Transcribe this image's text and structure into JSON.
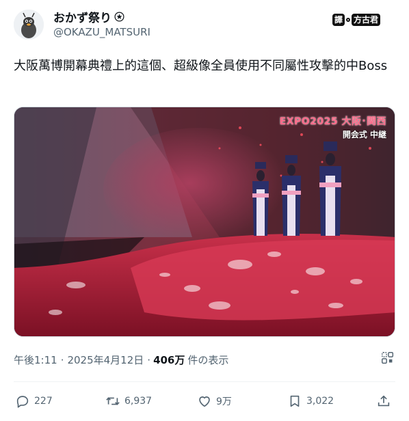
{
  "author": {
    "display_name": "おかず祭り",
    "handle": "@OKAZU_MATSURI",
    "avatar_icon": "cartoon-avatar",
    "badge_icon": "circled-star-badge"
  },
  "watermark": {
    "left": "譯",
    "right": "方古君"
  },
  "tweet": {
    "text": "大阪萬博開幕典禮上的這個、超級像全員使用不同屬性攻擊的中Boss"
  },
  "media": {
    "overlay_line1": "EXPO2025 大阪･関西",
    "overlay_line2": "開会式 中継"
  },
  "meta": {
    "time": "午後1:11",
    "sep1": "·",
    "date": "2025年4月12日",
    "sep2": "·",
    "views_count": "406万",
    "views_label": "件の表示"
  },
  "actions": {
    "replies": "227",
    "retweets": "6,937",
    "likes": "9万",
    "bookmarks": "3,022"
  },
  "colors": {
    "text_primary": "#0f1419",
    "text_secondary": "#536471",
    "divider": "#eff3f4"
  }
}
